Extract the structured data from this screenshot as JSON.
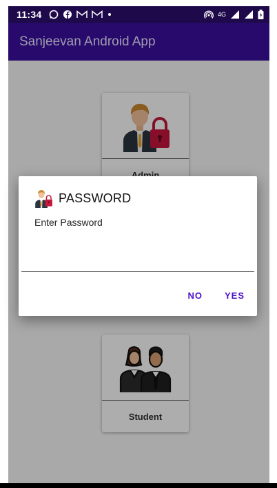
{
  "status_bar": {
    "time": "11:34",
    "left_icons": [
      "whatsapp-icon",
      "facebook-icon",
      "gmail-icon",
      "gmail-icon",
      "dot-icon"
    ],
    "right_icons": [
      "hotspot-icon",
      "4g-icon",
      "signal-icon",
      "signal-icon",
      "battery-icon"
    ],
    "network": "4G"
  },
  "app_bar": {
    "title": "Sanjeevan Android App"
  },
  "cards": {
    "admin": {
      "label": "Admin",
      "icon": "admin-lock-icon"
    },
    "student": {
      "label": "Student",
      "icon": "students-icon"
    }
  },
  "dialog": {
    "title": "PASSWORD",
    "icon": "admin-lock-icon",
    "message": "Enter Password",
    "input_value": "",
    "no_label": "NO",
    "yes_label": "YES"
  },
  "colors": {
    "status_bar": "#1e0a4a",
    "app_bar": "#3a0fa0",
    "accent": "#4a12c9"
  }
}
